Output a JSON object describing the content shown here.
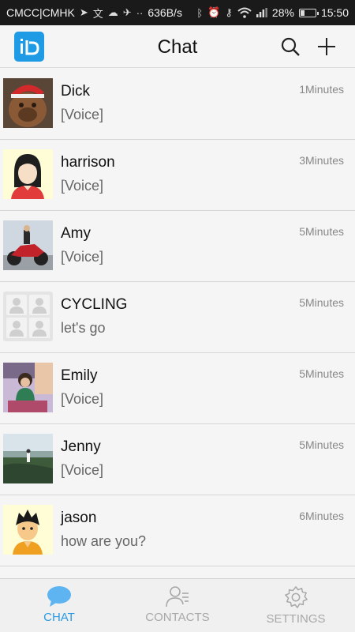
{
  "status_bar": {
    "carrier": "CMCC|CMHK",
    "net_speed": "636B/s",
    "battery": "28%",
    "battery_level": 0.28,
    "time": "15:50"
  },
  "header": {
    "title": "Chat"
  },
  "chats": [
    {
      "name": "Dick",
      "message": "[Voice]",
      "time": "1Minutes"
    },
    {
      "name": "harrison",
      "message": "[Voice]",
      "time": "3Minutes"
    },
    {
      "name": "Amy",
      "message": "[Voice]",
      "time": "5Minutes"
    },
    {
      "name": "CYCLING",
      "message": "let's go",
      "time": "5Minutes"
    },
    {
      "name": "Emily",
      "message": "[Voice]",
      "time": "5Minutes"
    },
    {
      "name": "Jenny",
      "message": "[Voice]",
      "time": "5Minutes"
    },
    {
      "name": "jason",
      "message": "how are you?",
      "time": "6Minutes"
    }
  ],
  "tabs": [
    {
      "label": "CHAT",
      "active": true
    },
    {
      "label": "CONTACTS",
      "active": false
    },
    {
      "label": "SETTINGS",
      "active": false
    }
  ],
  "colors": {
    "accent": "#2a9ae6",
    "logo_bg": "#1f9be6",
    "inactive": "#a8a8a8"
  }
}
